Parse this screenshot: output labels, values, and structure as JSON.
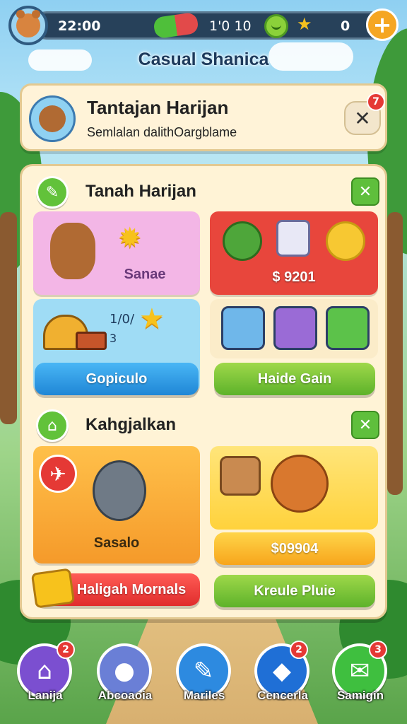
{
  "hud": {
    "time": "22:00",
    "energy": "1'0 10",
    "coins": "0",
    "plus_symbol": "+"
  },
  "screen_title": "Casual Shanica",
  "daily_challenge": {
    "title": "Tantajan Harijan",
    "subtitle": "Semlalan dalithOargblame",
    "badge": "7",
    "close_symbol": "✕"
  },
  "section1": {
    "title": "Tanah Harijan",
    "close_symbol": "✕",
    "tile_pink_label": "Sanae",
    "tile_red_price": "$ 9201",
    "tile_blue_count": "1/0/",
    "tile_blue_sub": "3",
    "button_blue": "Gopiculo",
    "button_green": "Haide Gain"
  },
  "section2": {
    "title": "Kahgjalkan",
    "close_symbol": "✕",
    "tile_orange_label": "Sasalo",
    "tile_yellow_price": "$09904",
    "button_red": "Haligah Mornals",
    "button_green": "Kreule Pluie"
  },
  "nav": {
    "items": [
      {
        "label": "Lanija",
        "badge": "2",
        "color": "#7b4fd0",
        "icon": "⌂"
      },
      {
        "label": "Abcoaoia",
        "badge": "",
        "color": "#6a7fd6",
        "icon": "●"
      },
      {
        "label": "Mariles",
        "badge": "",
        "color": "#2d8ae0",
        "icon": "✎"
      },
      {
        "label": "Cencerla",
        "badge": "2",
        "color": "#1f6fd6",
        "icon": "◆"
      },
      {
        "label": "Samigin",
        "badge": "3",
        "color": "#3fbf3f",
        "icon": "✉"
      }
    ]
  }
}
